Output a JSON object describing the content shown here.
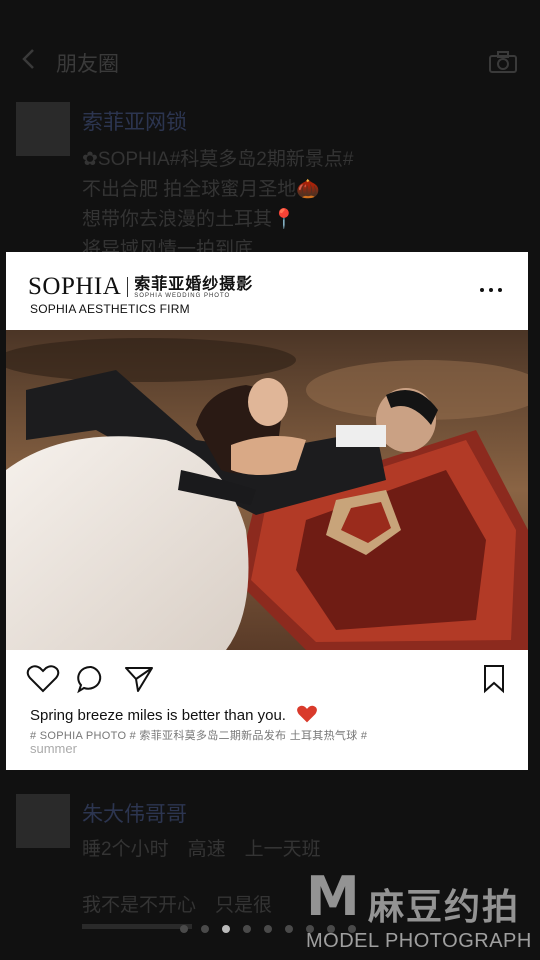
{
  "nav": {
    "title": "朋友圈"
  },
  "posts": [
    {
      "name": "索菲亚网锁",
      "lines": [
        "✿SOPHIA#科莫多岛2期新景点#",
        "不出合肥 拍全球蜜月圣地🌰",
        "想带你去浪漫的土耳其📍",
        "将异域风情一拍到底..."
      ]
    },
    {
      "name": "朱大伟哥哥",
      "lines": [
        "睡2个小时　高速　上一天班",
        "",
        "我不是不开心　只是很"
      ]
    }
  ],
  "card": {
    "brand_en": "SOPHIA",
    "brand_cn": "索菲亚婚纱摄影",
    "brand_sub": "SOPHIA WEDDING PHOTO",
    "firm": "SOPHIA AESTHETICS FIRM",
    "caption": "Spring breeze miles is better than you.",
    "tags_line1": "# SOPHIA PHOTO # 索菲亚科莫多岛二期新品发布 土耳其热气球 #",
    "tags_line2": "summer",
    "heart_color": "#d93a2b"
  },
  "pager": {
    "count": 9,
    "active_index": 2
  },
  "watermark": {
    "logo": "M",
    "cn": "麻豆约拍",
    "en": "MODEL PHOTOGRAPH"
  }
}
